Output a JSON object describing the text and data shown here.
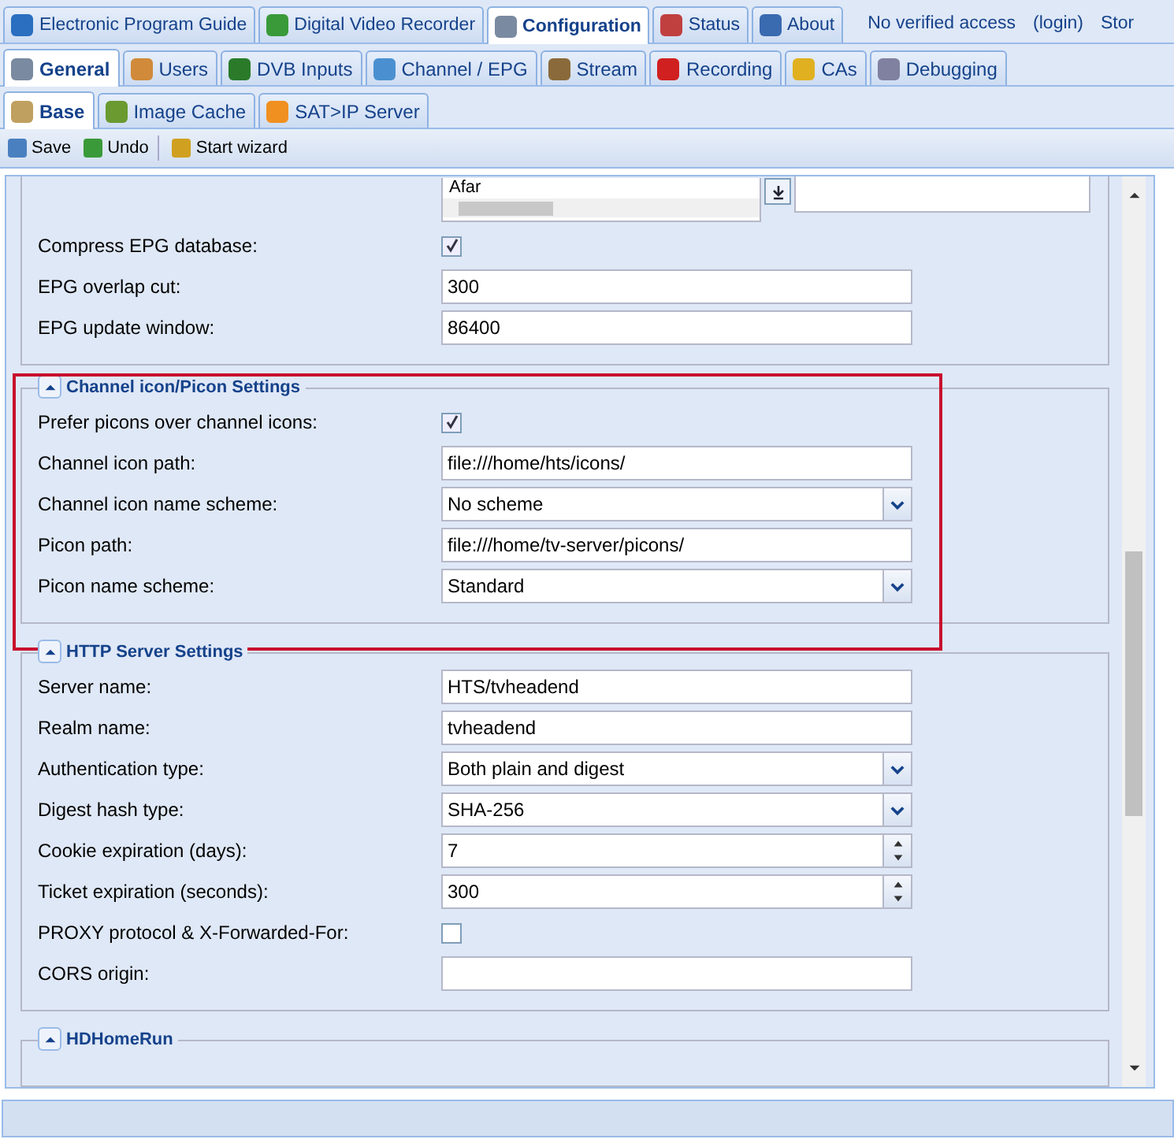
{
  "top_tabs": [
    {
      "label": "Electronic Program Guide",
      "selected": false
    },
    {
      "label": "Digital Video Recorder",
      "selected": false
    },
    {
      "label": "Configuration",
      "selected": true
    },
    {
      "label": "Status",
      "selected": false
    },
    {
      "label": "About",
      "selected": false
    }
  ],
  "header_links": [
    "No verified access",
    "(login)",
    "Stor"
  ],
  "sub_tabs": [
    {
      "label": "General",
      "selected": true
    },
    {
      "label": "Users",
      "selected": false
    },
    {
      "label": "DVB Inputs",
      "selected": false
    },
    {
      "label": "Channel / EPG",
      "selected": false
    },
    {
      "label": "Stream",
      "selected": false
    },
    {
      "label": "Recording",
      "selected": false
    },
    {
      "label": "CAs",
      "selected": false
    },
    {
      "label": "Debugging",
      "selected": false
    }
  ],
  "page_tabs": [
    {
      "label": "Base",
      "selected": true
    },
    {
      "label": "Image Cache",
      "selected": false
    },
    {
      "label": "SAT>IP Server",
      "selected": false
    }
  ],
  "toolbar": [
    "Save",
    "Undo",
    "Start wizard"
  ],
  "sections": [
    {
      "fields": [
        {
          "kind": "listbox",
          "value": "Afar"
        },
        {
          "kind": "checkbox",
          "label": "Compress EPG database:",
          "checked": true
        },
        {
          "kind": "text",
          "label": "EPG overlap cut:",
          "value": "300"
        },
        {
          "kind": "text",
          "label": "EPG update window:",
          "value": "86400"
        }
      ]
    },
    {
      "title": "Channel icon/Picon Settings",
      "highlighted": true,
      "fields": [
        {
          "kind": "checkbox",
          "label": "Prefer picons over channel icons:",
          "checked": true
        },
        {
          "kind": "text",
          "label": "Channel icon path:",
          "value": "file:///home/hts/icons/"
        },
        {
          "kind": "select",
          "label": "Channel icon name scheme:",
          "value": "No scheme"
        },
        {
          "kind": "text",
          "label": "Picon path:",
          "value": "file:///home/tv-server/picons/"
        },
        {
          "kind": "select",
          "label": "Picon name scheme:",
          "value": "Standard"
        }
      ]
    },
    {
      "title": "HTTP Server Settings",
      "highlighted": false,
      "fields": [
        {
          "kind": "text",
          "label": "Server name:",
          "value": "HTS/tvheadend"
        },
        {
          "kind": "text",
          "label": "Realm name:",
          "value": "tvheadend"
        },
        {
          "kind": "select",
          "label": "Authentication type:",
          "value": "Both plain and digest"
        },
        {
          "kind": "select",
          "label": "Digest hash type:",
          "value": "SHA-256"
        },
        {
          "kind": "spinner",
          "label": "Cookie expiration (days):",
          "value": "7"
        },
        {
          "kind": "spinner",
          "label": "Ticket expiration (seconds):",
          "value": "300"
        },
        {
          "kind": "checkbox",
          "label": "PROXY protocol & X-Forwarded-For:",
          "checked": false
        },
        {
          "kind": "text",
          "label": "CORS origin:"
        }
      ]
    },
    {
      "title": "HDHomeRun",
      "highlighted": false
    }
  ]
}
